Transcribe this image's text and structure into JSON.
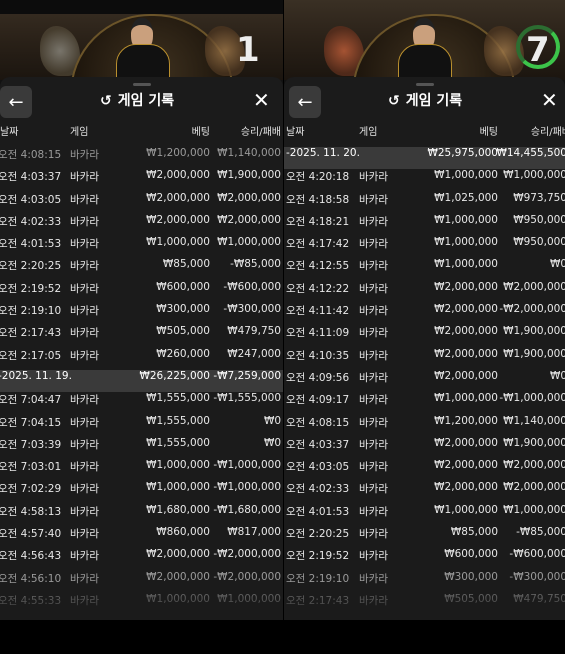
{
  "left": {
    "round_number": "1",
    "title": "게임 기록",
    "columns": [
      "날짜",
      "게임",
      "베팅",
      "승리/패배"
    ],
    "rows": [
      {
        "date": "오전 4:08:15",
        "game": "바카라",
        "bet": "₩1,200,000",
        "result": "₩1,140,000",
        "style": "half"
      },
      {
        "date": "오전 4:03:37",
        "game": "바카라",
        "bet": "₩2,000,000",
        "result": "₩1,900,000"
      },
      {
        "date": "오전 4:03:05",
        "game": "바카라",
        "bet": "₩2,000,000",
        "result": "₩2,000,000"
      },
      {
        "date": "오전 4:02:33",
        "game": "바카라",
        "bet": "₩2,000,000",
        "result": "₩2,000,000"
      },
      {
        "date": "오전 4:01:53",
        "game": "바카라",
        "bet": "₩1,000,000",
        "result": "₩1,000,000"
      },
      {
        "date": "오전 2:20:25",
        "game": "바카라",
        "bet": "₩85,000",
        "result": "-₩85,000"
      },
      {
        "date": "오전 2:19:52",
        "game": "바카라",
        "bet": "₩600,000",
        "result": "-₩600,000"
      },
      {
        "date": "오전 2:19:10",
        "game": "바카라",
        "bet": "₩300,000",
        "result": "-₩300,000"
      },
      {
        "date": "오전 2:17:43",
        "game": "바카라",
        "bet": "₩505,000",
        "result": "₩479,750"
      },
      {
        "date": "오전 2:17:05",
        "game": "바카라",
        "bet": "₩260,000",
        "result": "₩247,000"
      },
      {
        "date": "-2025. 11. 19.",
        "game": "",
        "bet": "₩26,225,000",
        "result": "-₩7,259,000",
        "style": "sum"
      },
      {
        "date": "오전 7:04:47",
        "game": "바카라",
        "bet": "₩1,555,000",
        "result": "-₩1,555,000"
      },
      {
        "date": "오전 7:04:15",
        "game": "바카라",
        "bet": "₩1,555,000",
        "result": "₩0"
      },
      {
        "date": "오전 7:03:39",
        "game": "바카라",
        "bet": "₩1,555,000",
        "result": "₩0"
      },
      {
        "date": "오전 7:03:01",
        "game": "바카라",
        "bet": "₩1,000,000",
        "result": "-₩1,000,000"
      },
      {
        "date": "오전 7:02:29",
        "game": "바카라",
        "bet": "₩1,000,000",
        "result": "-₩1,000,000"
      },
      {
        "date": "오전 4:58:13",
        "game": "바카라",
        "bet": "₩1,680,000",
        "result": "-₩1,680,000"
      },
      {
        "date": "오전 4:57:40",
        "game": "바카라",
        "bet": "₩860,000",
        "result": "₩817,000"
      },
      {
        "date": "오전 4:56:43",
        "game": "바카라",
        "bet": "₩2,000,000",
        "result": "-₩2,000,000"
      },
      {
        "date": "오전 4:56:10",
        "game": "바카라",
        "bet": "₩2,000,000",
        "result": "-₩2,000,000",
        "style": "half"
      },
      {
        "date": "오전 4:55:33",
        "game": "바카라",
        "bet": "₩1,000,000",
        "result": "₩1,000,000",
        "style": "dim"
      }
    ]
  },
  "right": {
    "round_number": "7",
    "title": "게임 기록",
    "columns": [
      "날짜",
      "게임",
      "베팅",
      "승리/패배"
    ],
    "rows": [
      {
        "date": "-2025. 11. 20.",
        "game": "",
        "bet": "₩25,975,000",
        "result": "₩14,455,500",
        "style": "sum"
      },
      {
        "date": "오전 4:20:18",
        "game": "바카라",
        "bet": "₩1,000,000",
        "result": "₩1,000,000"
      },
      {
        "date": "오전 4:18:58",
        "game": "바카라",
        "bet": "₩1,025,000",
        "result": "₩973,750"
      },
      {
        "date": "오전 4:18:21",
        "game": "바카라",
        "bet": "₩1,000,000",
        "result": "₩950,000"
      },
      {
        "date": "오전 4:17:42",
        "game": "바카라",
        "bet": "₩1,000,000",
        "result": "₩950,000"
      },
      {
        "date": "오전 4:12:55",
        "game": "바카라",
        "bet": "₩1,000,000",
        "result": "₩0"
      },
      {
        "date": "오전 4:12:22",
        "game": "바카라",
        "bet": "₩2,000,000",
        "result": "₩2,000,000"
      },
      {
        "date": "오전 4:11:42",
        "game": "바카라",
        "bet": "₩2,000,000",
        "result": "-₩2,000,000"
      },
      {
        "date": "오전 4:11:09",
        "game": "바카라",
        "bet": "₩2,000,000",
        "result": "₩1,900,000"
      },
      {
        "date": "오전 4:10:35",
        "game": "바카라",
        "bet": "₩2,000,000",
        "result": "₩1,900,000"
      },
      {
        "date": "오전 4:09:56",
        "game": "바카라",
        "bet": "₩2,000,000",
        "result": "₩0"
      },
      {
        "date": "오전 4:09:17",
        "game": "바카라",
        "bet": "₩1,000,000",
        "result": "-₩1,000,000"
      },
      {
        "date": "오전 4:08:15",
        "game": "바카라",
        "bet": "₩1,200,000",
        "result": "₩1,140,000"
      },
      {
        "date": "오전 4:03:37",
        "game": "바카라",
        "bet": "₩2,000,000",
        "result": "₩1,900,000"
      },
      {
        "date": "오전 4:03:05",
        "game": "바카라",
        "bet": "₩2,000,000",
        "result": "₩2,000,000"
      },
      {
        "date": "오전 4:02:33",
        "game": "바카라",
        "bet": "₩2,000,000",
        "result": "₩2,000,000"
      },
      {
        "date": "오전 4:01:53",
        "game": "바카라",
        "bet": "₩1,000,000",
        "result": "₩1,000,000"
      },
      {
        "date": "오전 2:20:25",
        "game": "바카라",
        "bet": "₩85,000",
        "result": "-₩85,000"
      },
      {
        "date": "오전 2:19:52",
        "game": "바카라",
        "bet": "₩600,000",
        "result": "-₩600,000"
      },
      {
        "date": "오전 2:19:10",
        "game": "바카라",
        "bet": "₩300,000",
        "result": "-₩300,000",
        "style": "half"
      },
      {
        "date": "오전 2:17:43",
        "game": "바카라",
        "bet": "₩505,000",
        "result": "₩479,750",
        "style": "dim"
      }
    ]
  },
  "colors": {
    "sheet": "#1b1b1b",
    "summary_row": "#3a3a3a",
    "timer_green": "#3cc44a",
    "gold": "#b98f2e"
  },
  "icons": {
    "back": "arrow-left-icon",
    "history": "history-icon",
    "close": "close-icon"
  }
}
